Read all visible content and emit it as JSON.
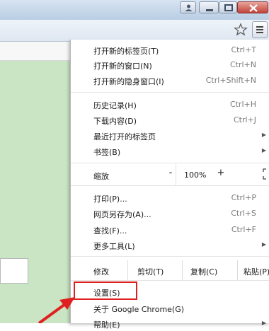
{
  "menu": {
    "new_tab": {
      "label": "打开新的标签页(T)",
      "shortcut": "Ctrl+T"
    },
    "new_window": {
      "label": "打开新的窗口(N)",
      "shortcut": "Ctrl+N"
    },
    "incognito": {
      "label": "打开新的隐身窗口(I)",
      "shortcut": "Ctrl+Shift+N"
    },
    "history": {
      "label": "历史记录(H)",
      "shortcut": "Ctrl+H"
    },
    "downloads": {
      "label": "下载内容(D)",
      "shortcut": "Ctrl+J"
    },
    "recent_tabs": {
      "label": "最近打开的标签页"
    },
    "bookmarks": {
      "label": "书签(B)"
    },
    "zoom": {
      "label": "缩放",
      "minus": "-",
      "value": "100%",
      "plus": "+"
    },
    "print": {
      "label": "打印(P)...",
      "shortcut": "Ctrl+P"
    },
    "save_as": {
      "label": "网页另存为(A)...",
      "shortcut": "Ctrl+S"
    },
    "find": {
      "label": "查找(F)...",
      "shortcut": "Ctrl+F"
    },
    "more_tools": {
      "label": "更多工具(L)"
    },
    "edit": {
      "label": "修改",
      "cut": "剪切(T)",
      "copy": "复制(C)",
      "paste": "粘贴(P)"
    },
    "settings": {
      "label": "设置(S)"
    },
    "about": {
      "label": "关于 Google Chrome(G)"
    },
    "help": {
      "label": "帮助(E)"
    }
  },
  "colors": {
    "highlight": "#e02020",
    "page_bg": "#c9e5c3"
  }
}
